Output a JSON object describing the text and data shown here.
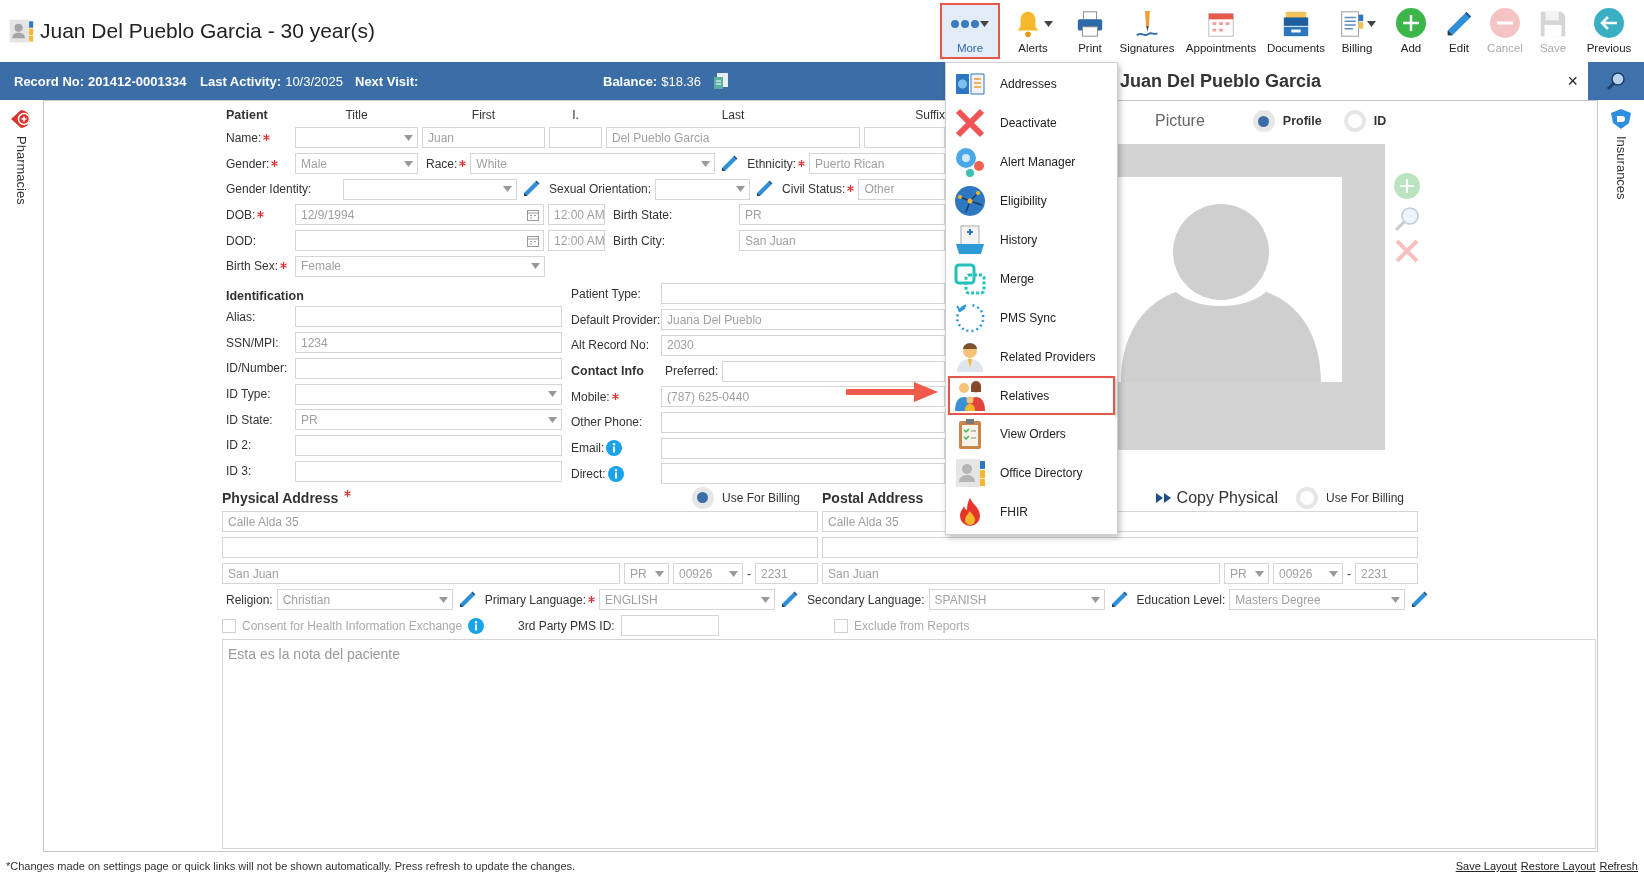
{
  "header": {
    "title": "Juan Del Pueblo Garcia - 30 year(s)",
    "toolbar": [
      {
        "label": "More",
        "has_dropdown": true,
        "selected": true,
        "disabled": false
      },
      {
        "label": "Alerts",
        "has_dropdown": true,
        "selected": false,
        "disabled": false
      },
      {
        "label": "Print",
        "has_dropdown": false,
        "selected": false,
        "disabled": false
      },
      {
        "label": "Signatures",
        "has_dropdown": false,
        "selected": false,
        "disabled": false
      },
      {
        "label": "Appointments",
        "has_dropdown": false,
        "selected": false,
        "disabled": false
      },
      {
        "label": "Documents",
        "has_dropdown": false,
        "selected": false,
        "disabled": false
      },
      {
        "label": "Billing",
        "has_dropdown": true,
        "selected": false,
        "disabled": false
      },
      {
        "label": "Add",
        "has_dropdown": false,
        "selected": false,
        "disabled": false
      },
      {
        "label": "Edit",
        "has_dropdown": false,
        "selected": false,
        "disabled": false
      },
      {
        "label": "Cancel",
        "has_dropdown": false,
        "selected": false,
        "disabled": true
      },
      {
        "label": "Save",
        "has_dropdown": false,
        "selected": false,
        "disabled": true
      },
      {
        "label": "Previous",
        "has_dropdown": false,
        "selected": false,
        "disabled": false
      }
    ]
  },
  "record_bar": {
    "items": [
      {
        "kind": "info",
        "label": "Record No:",
        "value": "201412-0001334"
      },
      {
        "kind": "info",
        "label": "Last Activity:",
        "value": "10/3/2025"
      },
      {
        "kind": "info",
        "label": "Next Visit:"
      },
      {
        "kind": "balance",
        "label": "Balance:",
        "value": "$18.36"
      }
    ],
    "search_panel": {
      "title": "Juan Del Pueblo Garcia",
      "close": "×"
    }
  },
  "sidebars": {
    "left": "Pharmacies",
    "right": "Insurances"
  },
  "patient": {
    "heading": "Patient",
    "name_columns": [
      "Title",
      "First",
      "I.",
      "Last",
      "Suffix"
    ],
    "lines": [
      {
        "items": [
          {
            "kind": "label",
            "text": "Name:",
            "required": true
          },
          {
            "kind": "select"
          },
          {
            "kind": "text",
            "value": "Juan"
          },
          {
            "kind": "text"
          },
          {
            "kind": "text",
            "value": "Del Pueblo Garcia"
          },
          {
            "kind": "text"
          }
        ]
      },
      {
        "items": [
          {
            "kind": "label",
            "text": "Gender:",
            "required": true
          },
          {
            "kind": "select",
            "value": "Male"
          },
          {
            "kind": "label",
            "text": "Race:",
            "required": true
          },
          {
            "kind": "select",
            "value": "White",
            "edit_button": true
          },
          {
            "kind": "label",
            "text": "Ethnicity:",
            "required": true
          },
          {
            "kind": "text",
            "value": "Puerto Rican"
          }
        ]
      },
      {
        "items": [
          {
            "kind": "label",
            "text": "Gender Identity:"
          },
          {
            "kind": "select",
            "edit_button": true
          },
          {
            "kind": "label",
            "text": "Sexual Orientation:"
          },
          {
            "kind": "select",
            "edit_button": true
          },
          {
            "kind": "label",
            "text": "Civil Status:",
            "required": true
          },
          {
            "kind": "text",
            "value": "Other"
          }
        ]
      },
      {
        "items": [
          {
            "kind": "label",
            "text": "DOB:",
            "required": true
          },
          {
            "kind": "date",
            "value": "12/9/1994"
          },
          {
            "kind": "time",
            "value": "12:00 AM"
          },
          {
            "kind": "label",
            "text": "Birth State:"
          },
          {
            "kind": "text",
            "value": "PR"
          }
        ]
      },
      {
        "items": [
          {
            "kind": "label",
            "text": "DOD:"
          },
          {
            "kind": "date"
          },
          {
            "kind": "time",
            "value": "12:00 AM"
          },
          {
            "kind": "label",
            "text": "Birth City:"
          },
          {
            "kind": "text",
            "value": "San Juan"
          }
        ]
      },
      {
        "items": [
          {
            "kind": "label",
            "text": "Birth Sex:",
            "required": true
          },
          {
            "kind": "select",
            "value": "Female"
          }
        ]
      }
    ]
  },
  "identification": {
    "rows": [
      [
        {
          "kind": "heading",
          "text": "Identification"
        }
      ],
      [
        {
          "kind": "label",
          "text": "Alias:"
        },
        {
          "kind": "text"
        }
      ],
      [
        {
          "kind": "label",
          "text": "SSN/MPI:"
        },
        {
          "kind": "text",
          "value": "1234"
        }
      ],
      [
        {
          "kind": "label",
          "text": "ID/Number:"
        },
        {
          "kind": "text"
        }
      ],
      [
        {
          "kind": "label",
          "text": "ID Type:"
        },
        {
          "kind": "select"
        }
      ],
      [
        {
          "kind": "label",
          "text": "ID State:"
        },
        {
          "kind": "select",
          "value": "PR"
        }
      ],
      [
        {
          "kind": "label",
          "text": "ID 2:"
        },
        {
          "kind": "text"
        }
      ],
      [
        {
          "kind": "label",
          "text": "ID 3:"
        },
        {
          "kind": "text"
        }
      ]
    ]
  },
  "details": {
    "rows": [
      [
        {
          "kind": "label",
          "text": "Patient Type:"
        },
        {
          "kind": "text"
        }
      ],
      [
        {
          "kind": "label",
          "text": "Default Provider:"
        },
        {
          "kind": "text",
          "value": "Juana Del Pueblo"
        }
      ],
      [
        {
          "kind": "label",
          "text": "Alt Record No:"
        },
        {
          "kind": "text",
          "value": "2030"
        }
      ],
      [
        {
          "kind": "heading",
          "text": "Contact Info"
        },
        {
          "kind": "label",
          "text": "Preferred:"
        },
        {
          "kind": "text"
        }
      ],
      [
        {
          "kind": "label",
          "text": "Mobile:",
          "required": true
        },
        {
          "kind": "text",
          "value": "(787) 625-0440"
        }
      ],
      [
        {
          "kind": "label",
          "text": "Other Phone:"
        },
        {
          "kind": "text"
        }
      ],
      [
        {
          "kind": "label",
          "text": "Email:",
          "info": true
        },
        {
          "kind": "text"
        }
      ],
      [
        {
          "kind": "label",
          "text": "Direct:",
          "info": true
        },
        {
          "kind": "text"
        }
      ]
    ]
  },
  "picture": {
    "title": "Picture",
    "options": [
      {
        "label": "Profile",
        "selected": true
      },
      {
        "label": "ID",
        "selected": false
      }
    ]
  },
  "physical_address": {
    "title": "Physical Address",
    "required": true,
    "use_for_billing": {
      "label": "Use For Billing",
      "selected": true
    },
    "lines": [
      [
        {
          "kind": "text",
          "value": "Calle Alda 35"
        }
      ],
      [
        {
          "kind": "text"
        }
      ],
      [
        {
          "kind": "text",
          "value": "San Juan"
        },
        {
          "kind": "select",
          "value": "PR"
        },
        {
          "kind": "select",
          "value": "00926"
        },
        {
          "kind": "separator",
          "text": "-"
        },
        {
          "kind": "text",
          "value": "2231"
        }
      ]
    ]
  },
  "postal_address": {
    "title": "Postal Address",
    "copy_button": "Copy Physical",
    "use_for_billing": {
      "label": "Use For Billing",
      "selected": false
    },
    "lines": [
      [
        {
          "kind": "text",
          "value": "Calle Alda 35"
        }
      ],
      [
        {
          "kind": "text"
        }
      ],
      [
        {
          "kind": "text",
          "value": "San Juan"
        },
        {
          "kind": "select",
          "value": "PR"
        },
        {
          "kind": "select",
          "value": "00926"
        },
        {
          "kind": "separator",
          "text": "-"
        },
        {
          "kind": "text",
          "value": "2231"
        }
      ]
    ]
  },
  "preferences": [
    {
      "kind": "label",
      "text": "Religion:"
    },
    {
      "kind": "select",
      "value": "Christian",
      "edit_button": true
    },
    {
      "kind": "label",
      "text": "Primary Language:",
      "required": true
    },
    {
      "kind": "select",
      "value": "ENGLISH",
      "edit_button": true
    },
    {
      "kind": "label",
      "text": "Secondary Language:"
    },
    {
      "kind": "select",
      "value": "SPANISH",
      "edit_button": true
    },
    {
      "kind": "label",
      "text": "Education Level:"
    },
    {
      "kind": "select",
      "value": "Masters Degree",
      "edit_button": true
    }
  ],
  "options": [
    {
      "kind": "checkbox",
      "label": "Consent for Health Information Exchange",
      "checked": false,
      "info": true
    },
    {
      "kind": "field",
      "label": "3rd Party PMS ID:"
    },
    {
      "kind": "checkbox",
      "label": "Exclude from Reports",
      "checked": false
    }
  ],
  "notes": {
    "value": "Esta es la nota del paciente"
  },
  "more_menu": {
    "items": [
      {
        "label": "Addresses",
        "selected": false
      },
      {
        "label": "Deactivate",
        "selected": false
      },
      {
        "label": "Alert Manager",
        "selected": false
      },
      {
        "label": "Eligibility",
        "selected": false
      },
      {
        "label": "History",
        "selected": false
      },
      {
        "label": "Merge",
        "selected": false
      },
      {
        "label": "PMS Sync",
        "selected": false
      },
      {
        "label": "Related Providers",
        "selected": false
      },
      {
        "label": "Relatives",
        "selected": true
      },
      {
        "label": "View Orders",
        "selected": false
      },
      {
        "label": "Office Directory",
        "selected": false
      },
      {
        "label": "FHIR",
        "selected": false
      }
    ]
  },
  "footer": {
    "note": "*Changes made on settings page or quick links will not be shown automatically. Press refresh to update the changes.",
    "links": [
      "Save Layout",
      "Restore Layout",
      "Refresh"
    ]
  }
}
